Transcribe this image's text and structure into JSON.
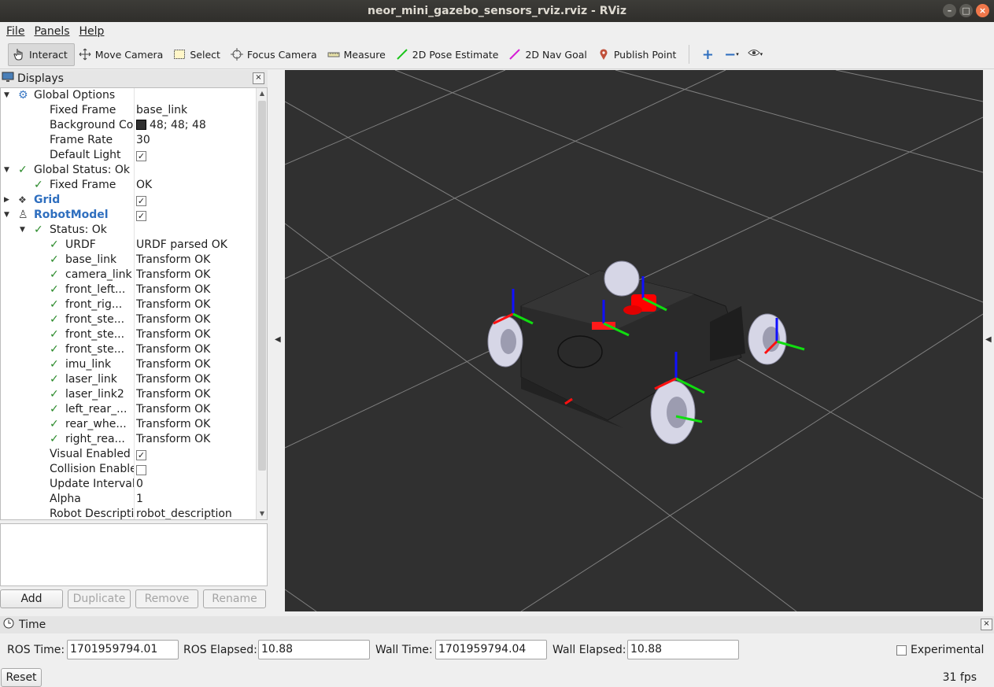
{
  "window": {
    "title": "neor_mini_gazebo_sensors_rviz.rviz - RViz"
  },
  "menu": {
    "file": "File",
    "panels": "Panels",
    "help": "Help"
  },
  "toolbar": {
    "interact": "Interact",
    "move_camera": "Move Camera",
    "select": "Select",
    "focus_camera": "Focus Camera",
    "measure": "Measure",
    "pose_estimate": "2D Pose Estimate",
    "nav_goal": "2D Nav Goal",
    "publish_point": "Publish Point"
  },
  "displays": {
    "title": "Displays",
    "rows": [
      {
        "label": "Global Options",
        "value": ""
      },
      {
        "label": "Fixed Frame",
        "value": "base_link"
      },
      {
        "label": "Background Color",
        "value": "48; 48; 48"
      },
      {
        "label": "Frame Rate",
        "value": "30"
      },
      {
        "label": "Default Light",
        "value": ""
      },
      {
        "label": "Global Status: Ok",
        "value": ""
      },
      {
        "label": "Fixed Frame",
        "value": "OK"
      },
      {
        "label": "Grid",
        "value": ""
      },
      {
        "label": "RobotModel",
        "value": ""
      },
      {
        "label": "Status: Ok",
        "value": ""
      },
      {
        "label": "URDF",
        "value": "URDF parsed OK"
      },
      {
        "label": "base_link",
        "value": "Transform OK"
      },
      {
        "label": "camera_link",
        "value": "Transform OK"
      },
      {
        "label": "front_left...",
        "value": "Transform OK"
      },
      {
        "label": "front_rig...",
        "value": "Transform OK"
      },
      {
        "label": "front_ste...",
        "value": "Transform OK"
      },
      {
        "label": "front_ste...",
        "value": "Transform OK"
      },
      {
        "label": "front_ste...",
        "value": "Transform OK"
      },
      {
        "label": "imu_link",
        "value": "Transform OK"
      },
      {
        "label": "laser_link",
        "value": "Transform OK"
      },
      {
        "label": "laser_link2",
        "value": "Transform OK"
      },
      {
        "label": "left_rear_...",
        "value": "Transform OK"
      },
      {
        "label": "rear_whe...",
        "value": "Transform OK"
      },
      {
        "label": "right_rea...",
        "value": "Transform OK"
      },
      {
        "label": "Visual Enabled",
        "value": ""
      },
      {
        "label": "Collision Enabled",
        "value": ""
      },
      {
        "label": "Update Interval",
        "value": "0"
      },
      {
        "label": "Alpha",
        "value": "1"
      },
      {
        "label": "Robot Description",
        "value": "robot_description"
      }
    ],
    "checked": {
      "default_light": true,
      "grid": true,
      "robot_model": true,
      "visual_enabled": true,
      "collision_enabled": false
    },
    "background_color_hex": "#303030",
    "buttons": {
      "add": "Add",
      "duplicate": "Duplicate",
      "remove": "Remove",
      "rename": "Rename"
    }
  },
  "time": {
    "title": "Time",
    "ros_time_label": "ROS Time:",
    "ros_time": "1701959794.01",
    "ros_elapsed_label": "ROS Elapsed:",
    "ros_elapsed": "10.88",
    "wall_time_label": "Wall Time:",
    "wall_time": "1701959794.04",
    "wall_elapsed_label": "Wall Elapsed:",
    "wall_elapsed": "10.88",
    "experimental": "Experimental",
    "reset": "Reset",
    "fps": "31 fps"
  },
  "colors": {
    "accent_blue": "#2f6fbf",
    "ok_green": "#2a8a2a",
    "viewport_bg": "#303030"
  }
}
